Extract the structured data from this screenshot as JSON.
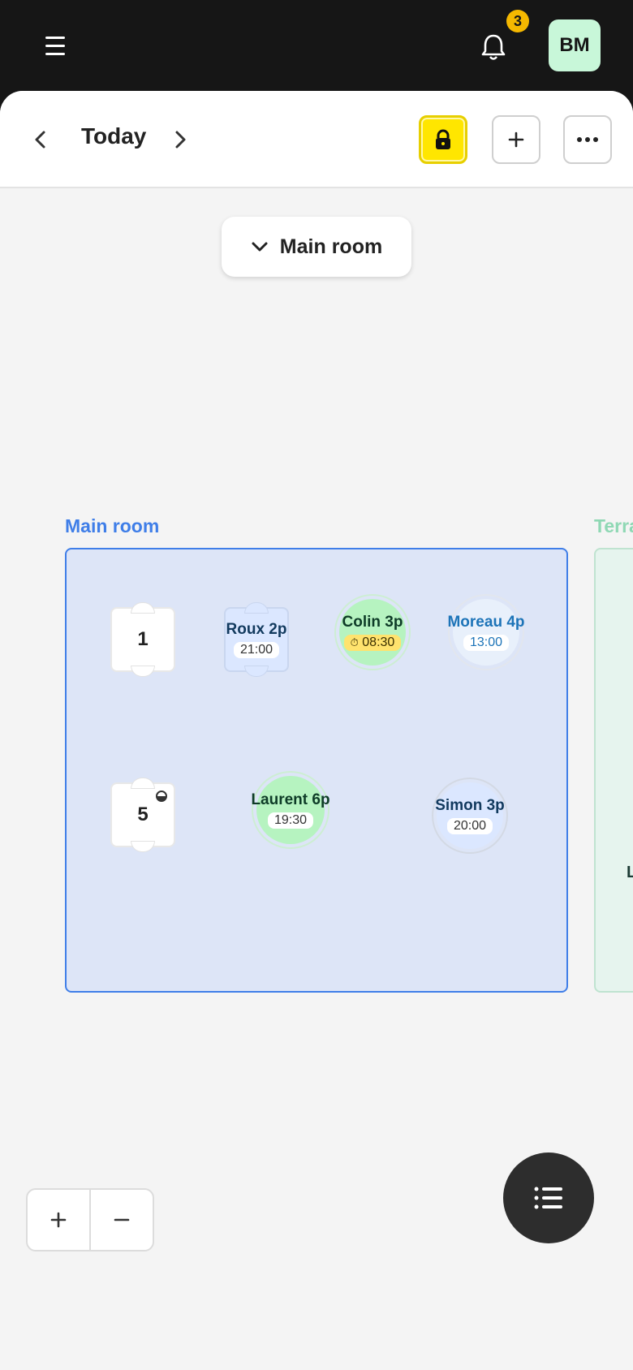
{
  "topbar": {
    "notification_count": "3",
    "avatar_initials": "BM"
  },
  "header": {
    "date_label": "Today"
  },
  "room_selector": {
    "label": "Main room"
  },
  "rooms": [
    {
      "name": "Main room",
      "color": "#3f7ee8"
    },
    {
      "name": "Terra",
      "color": "#8fd8b4"
    }
  ],
  "tables": {
    "t1": {
      "number": "1"
    },
    "t5": {
      "number": "5"
    },
    "roux": {
      "name": "Roux 2p",
      "time": "21:00"
    },
    "colin": {
      "name": "Colin 3p",
      "time": "08:30",
      "time_icon": "timer-icon"
    },
    "moreau": {
      "name": "Moreau 4p",
      "time": "13:00"
    },
    "laurent": {
      "name": "Laurent 6p",
      "time": "19:30"
    },
    "simon": {
      "name": "Simon 3p",
      "time": "20:00"
    }
  },
  "terrace_peek": "L",
  "colors": {
    "accent_lock": "#ffe600",
    "reservation_seated": "#b6f3c0",
    "reservation_upcoming": "#dbe7ff",
    "badge": "#f5b800"
  }
}
